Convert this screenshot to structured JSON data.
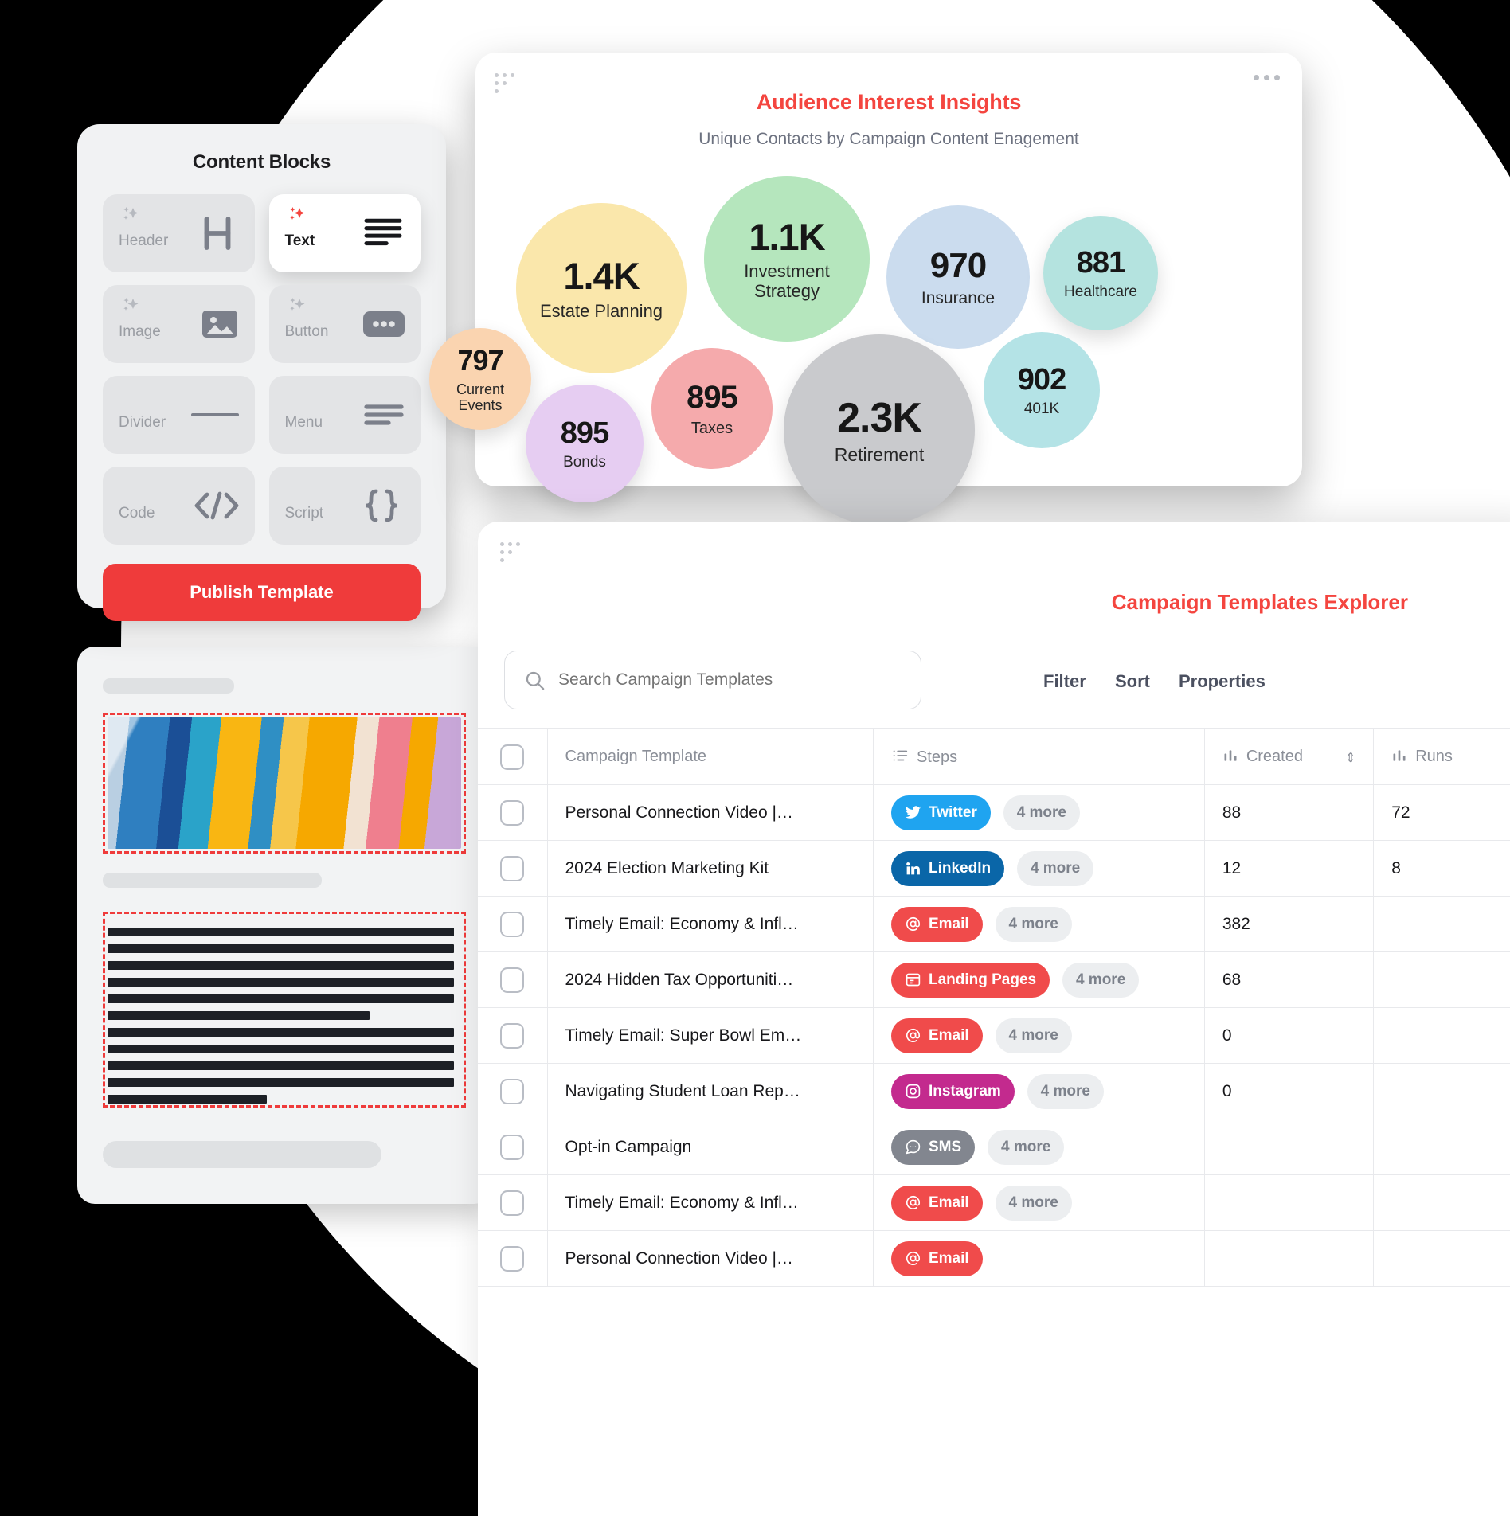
{
  "content_blocks": {
    "title": "Content Blocks",
    "tiles": [
      {
        "label": "Header",
        "icon": "header-h-icon",
        "active": false,
        "sparkle": true
      },
      {
        "label": "Text",
        "icon": "text-lines-icon",
        "active": true,
        "sparkle": true
      },
      {
        "label": "Image",
        "icon": "image-icon",
        "active": false,
        "sparkle": true
      },
      {
        "label": "Button",
        "icon": "button-icon",
        "active": false,
        "sparkle": true
      },
      {
        "label": "Divider",
        "icon": "divider-icon",
        "active": false,
        "sparkle": false
      },
      {
        "label": "Menu",
        "icon": "menu-icon",
        "active": false,
        "sparkle": false
      },
      {
        "label": "Code",
        "icon": "code-icon",
        "active": false,
        "sparkle": false
      },
      {
        "label": "Script",
        "icon": "script-braces-icon",
        "active": false,
        "sparkle": false
      }
    ],
    "publish_button": "Publish Template"
  },
  "insights": {
    "title": "Audience Interest Insights",
    "subtitle": "Unique Contacts by Campaign Content Enagement"
  },
  "chart_data": {
    "type": "bubble",
    "title": "Audience Interest Insights",
    "subtitle": "Unique Contacts by Campaign Content Enagement",
    "categories": [
      "Estate Planning",
      "Investment Strategy",
      "Insurance",
      "Healthcare",
      "Current Events",
      "Bonds",
      "Taxes",
      "Retirement",
      "401K"
    ],
    "values": [
      1400,
      1100,
      970,
      881,
      797,
      895,
      895,
      2300,
      902
    ],
    "labels": [
      "1.4K",
      "1.1K",
      "970",
      "881",
      "797",
      "895",
      "895",
      "2.3K",
      "902"
    ],
    "colors": [
      "#fae7ab",
      "#b5e6bd",
      "#cbdcee",
      "#b4e3df",
      "#fad4b0",
      "#e6cdf2",
      "#f5aaac",
      "#c9cacd",
      "#b4e3e6"
    ],
    "legend": "none",
    "grid": false
  },
  "explorer": {
    "title": "Campaign Templates Explorer",
    "search_placeholder": "Search Campaign Templates",
    "search_value": "",
    "toolbar": {
      "filter": "Filter",
      "sort": "Sort",
      "properties": "Properties"
    },
    "columns": [
      {
        "key": "name",
        "label": "Campaign Template",
        "icon": "none"
      },
      {
        "key": "steps",
        "label": "Steps",
        "icon": "list-icon"
      },
      {
        "key": "created",
        "label": "Created",
        "icon": "bars-icon",
        "sortable": true
      },
      {
        "key": "runs",
        "label": "Runs",
        "icon": "bars-icon"
      }
    ],
    "more_label": "4 more",
    "rows": [
      {
        "name": "Personal Connection Video |…",
        "channel": "Twitter",
        "channel_icon": "twitter-icon",
        "channel_color": "#1fa4f0",
        "more": "4 more",
        "created": "88",
        "runs": "72"
      },
      {
        "name": "2024 Election Marketing Kit",
        "channel": "LinkedIn",
        "channel_icon": "linkedin-icon",
        "channel_color": "#0a66a8",
        "more": "4 more",
        "created": "12",
        "runs": "8"
      },
      {
        "name": "Timely Email: Economy & Infl…",
        "channel": "Email",
        "channel_icon": "at-icon",
        "channel_color": "#f04b4b",
        "more": "4 more",
        "created": "382",
        "runs": ""
      },
      {
        "name": "2024 Hidden Tax Opportuniti…",
        "channel": "Landing Pages",
        "channel_icon": "landing-page-icon",
        "channel_color": "#f04b4b",
        "more": "4 more",
        "created": "68",
        "runs": ""
      },
      {
        "name": "Timely Email: Super Bowl Em…",
        "channel": "Email",
        "channel_icon": "at-icon",
        "channel_color": "#f04b4b",
        "more": "4 more",
        "created": "0",
        "runs": ""
      },
      {
        "name": "Navigating Student Loan Rep…",
        "channel": "Instagram",
        "channel_icon": "instagram-icon",
        "channel_color": "#c32a8e",
        "more": "4 more",
        "created": "0",
        "runs": ""
      },
      {
        "name": "Opt-in Campaign",
        "channel": "SMS",
        "channel_icon": "sms-icon",
        "channel_color": "#82868f",
        "more": "4 more",
        "created": "",
        "runs": ""
      },
      {
        "name": "Timely Email: Economy & Infl…",
        "channel": "Email",
        "channel_icon": "at-icon",
        "channel_color": "#f04b4b",
        "more": "4 more",
        "created": "",
        "runs": ""
      },
      {
        "name": "Personal Connection Video |…",
        "channel": "Email",
        "channel_icon": "at-icon",
        "channel_color": "#f04b4b",
        "more": "",
        "created": "",
        "runs": ""
      }
    ]
  },
  "colors": {
    "brand_red": "#f4453f",
    "publish_red": "#ef3b3b",
    "selection_dash": "#ef3b3b"
  }
}
